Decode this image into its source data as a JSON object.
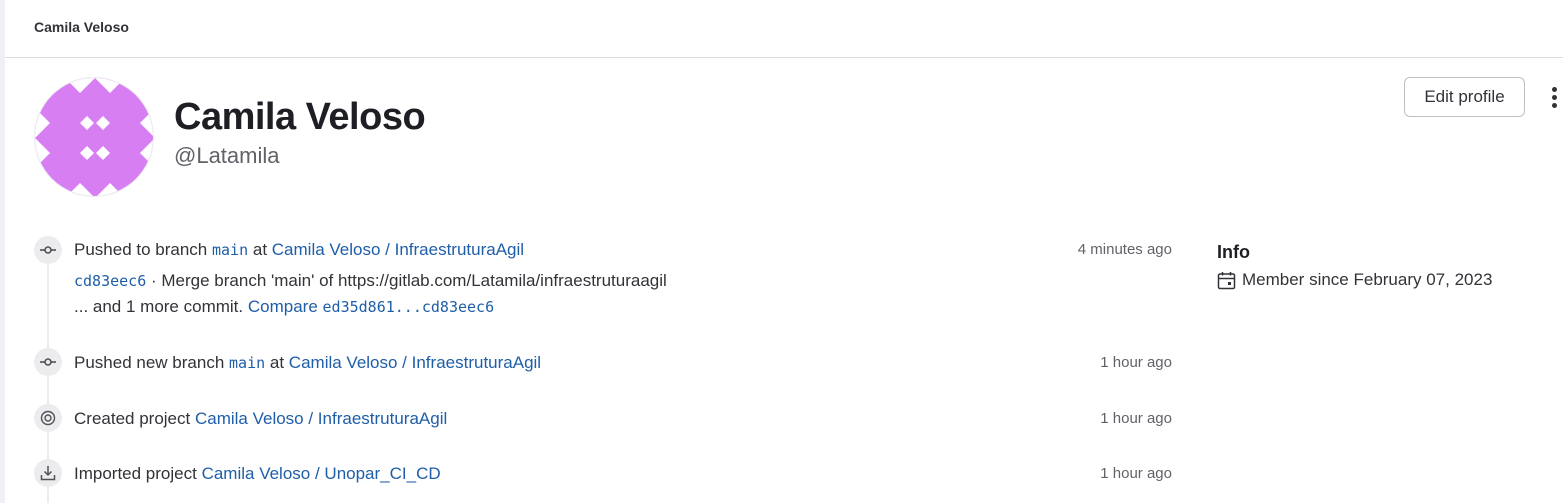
{
  "breadcrumb": {
    "label": "Camila Veloso"
  },
  "profile": {
    "name": "Camila Veloso",
    "username": "@Latamila",
    "edit_label": "Edit profile",
    "avatar_color": "#d67ef2"
  },
  "activity": [
    {
      "icon": "commit-icon",
      "action": "Pushed to branch",
      "branch": "main",
      "at": "at",
      "project": "Camila Veloso / InfraestruturaAgil",
      "time": "4 minutes ago",
      "commit_sha": "cd83eec6",
      "commit_sep": "·",
      "commit_message": "Merge branch 'main' of https://gitlab.com/Latamila/infraestruturaagil",
      "more_text": "... and 1 more commit.",
      "compare_label": "Compare",
      "compare_range": "ed35d861...cd83eec6"
    },
    {
      "icon": "commit-icon",
      "action": "Pushed new branch",
      "branch": "main",
      "at": "at",
      "project": "Camila Veloso / InfraestruturaAgil",
      "time": "1 hour ago"
    },
    {
      "icon": "target-icon",
      "action": "Created project",
      "project": "Camila Veloso / InfraestruturaAgil",
      "time": "1 hour ago"
    },
    {
      "icon": "import-icon",
      "action": "Imported project",
      "project": "Camila Veloso / Unopar_CI_CD",
      "time": "1 hour ago"
    }
  ],
  "info": {
    "title": "Info",
    "member_since": "Member since February 07, 2023"
  },
  "colors": {
    "link": "#1f5ea8",
    "text": "#333238",
    "muted": "#626168"
  }
}
